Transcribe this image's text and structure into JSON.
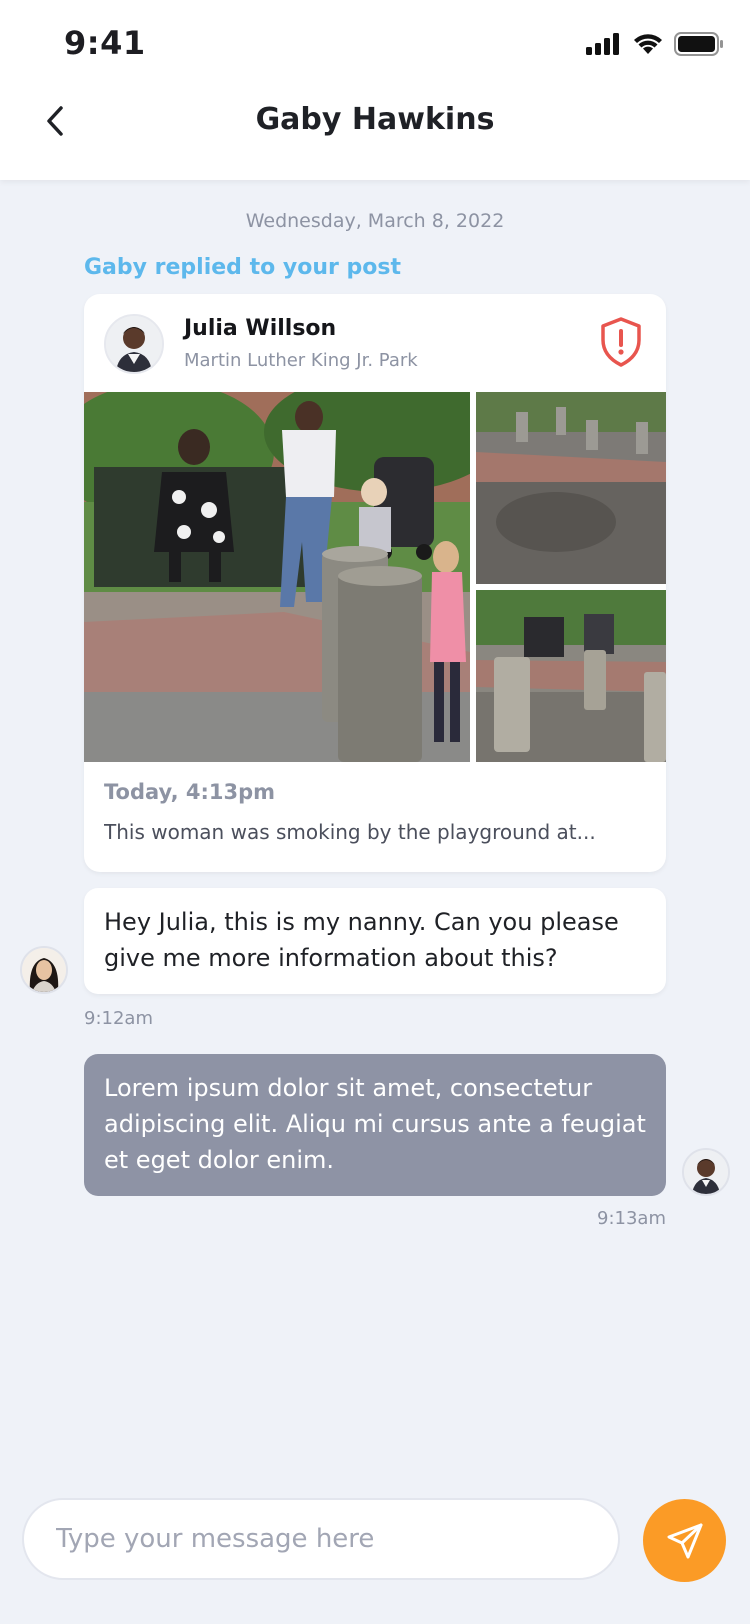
{
  "status_bar": {
    "time": "9:41"
  },
  "header": {
    "title": "Gaby Hawkins"
  },
  "thread": {
    "date": "Wednesday, March 8, 2022",
    "reply_label": "Gaby replied to your post"
  },
  "post": {
    "author": "Julia Willson",
    "location": "Martin Luther King Jr. Park",
    "time": "Today, 4:13pm",
    "text": "This woman was smoking by the playground at..."
  },
  "messages": [
    {
      "text": "Hey Julia, this is my nanny. Can you please give me more information about this?",
      "time": "9:12am"
    },
    {
      "text": "Lorem ipsum dolor sit amet, consectetur adipiscing elit. Aliqu mi cursus ante a feugiat et eget dolor enim.",
      "time": "9:13am"
    }
  ],
  "composer": {
    "placeholder": "Type your message here"
  },
  "colors": {
    "accent_blue": "#5db8ec",
    "send_orange": "#fb9b26",
    "report_red": "#e8554e",
    "outgoing_bubble": "#8e93a5",
    "background": "#eff2f8"
  },
  "icons": {
    "back": "chevron-left-icon",
    "report": "shield-alert-icon",
    "send": "paper-plane-icon",
    "signal": "signal-icon",
    "wifi": "wifi-icon",
    "battery": "battery-icon"
  }
}
